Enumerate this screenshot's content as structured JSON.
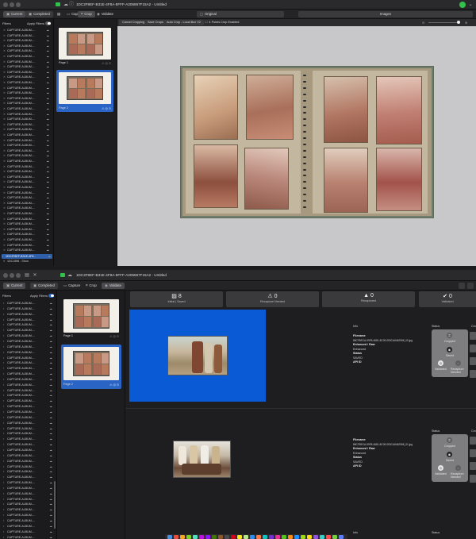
{
  "window1": {
    "title": "1DC2F8EF-B31E-4F8A-8FFF-A205867F15A2 - Untitled",
    "tabs": {
      "current": "Current",
      "completed": "Completed"
    },
    "toolbar": {
      "capture": "Capture",
      "crop": "Crop",
      "validate": "Validate",
      "original": "Original",
      "images": "Images"
    },
    "crop_actions": {
      "cancel": "Cancel Cropping",
      "save": "Save Crops",
      "auto": "Auto Crop - Local Box V2",
      "points": "4 Points Crop Enabled"
    },
    "filters_label": "Filters",
    "apply_filters": "Apply Filters",
    "album_items": [
      "CAPTURE-ALBUM-...",
      "CAPTURE-ALBUM-...",
      "CAPTURE-ALBUM-...",
      "CAPTURE-ALBUM-...",
      "CAPTURE-ALBUM-...",
      "CAPTURE-ALBUM-...",
      "CAPTURE-ALBUM-...",
      "CAPTURE-ALBUM-...",
      "CAPTURE-ALBUM-...",
      "CAPTURE-ALBUM-...",
      "CAPTURE-ALBUM-...",
      "CAPTURE-ALBUM-...",
      "CAPTURE-ALBUM-...",
      "CAPTURE-ALBUM-...",
      "CAPTURE-ALBUM-...",
      "CAPTURE-ALBUM-...",
      "CAPTURE-ALBUM-...",
      "CAPTURE-ALBUM-...",
      "CAPTURE-ALBUM-...",
      "CAPTURE-ALBUM-...",
      "CAPTURE-ALBUM-...",
      "CAPTURE-ALBUM-...",
      "CAPTURE-ALBUM-...",
      "CAPTURE-ALBUM-...",
      "CAPTURE-ALBUM-...",
      "CAPTURE-ALBUM-...",
      "CAPTURE-ALBUM-...",
      "CAPTURE-ALBUM-...",
      "CAPTURE-ALBUM-...",
      "CAPTURE-ALBUM-...",
      "CAPTURE-ALBUM-...",
      "CAPTURE-ALBUM-...",
      "CAPTURE-ALBUM-...",
      "CAPTURE-ALBUM-...",
      "CAPTURE-ALBUM-...",
      "CAPTURE-ALBUM-...",
      "CAPTURE-ALBUM-...",
      "CAPTURE-ALBUM-...",
      "CAPTURE-ALBUM-...",
      "CAPTURE-ALBUM-...",
      "CAPTURE-ALBUM-...",
      "CAPTURE-ALBUM-...",
      "CAPTURE-ALBUM-..."
    ],
    "group_label": "1DC1598 - Shun",
    "selected_item": "1DC2F8EF-B31E-4F8...",
    "pages": [
      {
        "label": "Page 1"
      },
      {
        "label": "Page 2"
      }
    ]
  },
  "window2": {
    "title": "1DC2F8EF-B31E-4F8A-8FFF-A205867F15A2 - Untitled",
    "tabs": {
      "current": "Current",
      "completed": "Completed"
    },
    "toolbar": {
      "capture": "Capture",
      "crop": "Crop",
      "validate": "Validate"
    },
    "filters_label": "Filters",
    "apply_filters": "Apply Filters",
    "album_items": [
      "CAPTURE-ALBUM-...",
      "CAPTURE-ALBUM-...",
      "CAPTURE-ALBUM-...",
      "CAPTURE-ALBUM-...",
      "CAPTURE-ALBUM-...",
      "CAPTURE-ALBUM-...",
      "CAPTURE-ALBUM-...",
      "CAPTURE-ALBUM-...",
      "CAPTURE-ALBUM-...",
      "CAPTURE-ALBUM-...",
      "CAPTURE-ALBUM-...",
      "CAPTURE-ALBUM-...",
      "CAPTURE-ALBUM-...",
      "CAPTURE-ALBUM-...",
      "CAPTURE-ALBUM-...",
      "CAPTURE-ALBUM-...",
      "CAPTURE-ALBUM-...",
      "CAPTURE-ALBUM-...",
      "CAPTURE-ALBUM-...",
      "CAPTURE-ALBUM-...",
      "CAPTURE-ALBUM-...",
      "CAPTURE-ALBUM-...",
      "CAPTURE-ALBUM-...",
      "CAPTURE-ALBUM-...",
      "CAPTURE-ALBUM-...",
      "CAPTURE-ALBUM-...",
      "CAPTURE-ALBUM-...",
      "CAPTURE-ALBUM-...",
      "CAPTURE-ALBUM-...",
      "CAPTURE-ALBUM-...",
      "CAPTURE-ALBUM-...",
      "CAPTURE-ALBUM-...",
      "CAPTURE-ALBUM-...",
      "CAPTURE-ALBUM-...",
      "CAPTURE-ALBUM-...",
      "CAPTURE-ALBUM-...",
      "CAPTURE-ALBUM-...",
      "CAPTURE-ALBUM-...",
      "CAPTURE-ALBUM-...",
      "CAPTURE-ALBUM-...",
      "CAPTURE-ALBUM-...",
      "CAPTURE-ALBUM-...",
      "CAPTURE-ALBUM-...",
      "CAPTURE-ALBUM-..."
    ],
    "pages": [
      {
        "label": "Page 1"
      },
      {
        "label": "Page 2"
      }
    ],
    "summary": [
      {
        "value": "8",
        "label": "Initial | Saved"
      },
      {
        "value": "0",
        "label": "Recapture Needed"
      },
      {
        "value": "0",
        "label": "Recaptured"
      },
      {
        "value": "0",
        "label": "Validated"
      }
    ],
    "results": [
      {
        "info_label": "Info",
        "filename_key": "Filename",
        "filename": "88CF8ECA-59F8-4681-8C09-053CA6462968_00.jpg",
        "enhanced_key": "Enhanced / Raw",
        "enhanced": "Enhanced",
        "status_key": "Status",
        "status": "SAVED",
        "api_key": "API ID",
        "status_label": "Status",
        "cropped": "Cropped",
        "saved": "Saved",
        "validated": "Validated",
        "recapture": "Recapture Needed"
      },
      {
        "info_label": "Info",
        "filename_key": "Filename",
        "filename": "88CF8ECA-59F8-4681-8C09-053CA6462968_01.jpg",
        "enhanced_key": "Enhanced / Raw",
        "enhanced": "Enhanced",
        "status_key": "Status",
        "status": "SAVED",
        "api_key": "API ID",
        "status_label": "Status",
        "cropped": "Cropped",
        "saved": "Saved",
        "validated": "Validated",
        "recapture": "Recapture Needed"
      }
    ],
    "footer_info": "Info",
    "footer_status": "Status"
  },
  "colors": {
    "selection": "#2a64c4",
    "accent_green": "#30c24a",
    "window_bg": "#1e1e20"
  }
}
